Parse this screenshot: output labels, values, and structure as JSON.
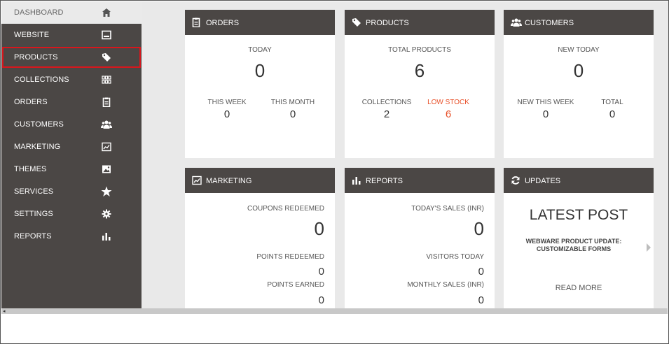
{
  "sidebar": {
    "items": [
      {
        "label": "DASHBOARD",
        "icon": "home-icon"
      },
      {
        "label": "WEBSITE",
        "icon": "window-icon"
      },
      {
        "label": "PRODUCTS",
        "icon": "tag-icon"
      },
      {
        "label": "COLLECTIONS",
        "icon": "grid-icon"
      },
      {
        "label": "ORDERS",
        "icon": "clipboard-icon"
      },
      {
        "label": "CUSTOMERS",
        "icon": "users-icon"
      },
      {
        "label": "MARKETING",
        "icon": "chart-icon"
      },
      {
        "label": "THEMES",
        "icon": "image-icon"
      },
      {
        "label": "SERVICES",
        "icon": "star-icon"
      },
      {
        "label": "SETTINGS",
        "icon": "gear-icon"
      },
      {
        "label": "REPORTS",
        "icon": "bar-chart-icon"
      }
    ]
  },
  "orders": {
    "title": "ORDERS",
    "today_label": "TODAY",
    "today_value": "0",
    "week_label": "THIS WEEK",
    "week_value": "0",
    "month_label": "THIS MONTH",
    "month_value": "0"
  },
  "products": {
    "title": "PRODUCTS",
    "total_label": "TOTAL PRODUCTS",
    "total_value": "6",
    "collections_label": "COLLECTIONS",
    "collections_value": "2",
    "lowstock_label": "LOW STOCK",
    "lowstock_value": "6"
  },
  "customers": {
    "title": "CUSTOMERS",
    "new_today_label": "NEW TODAY",
    "new_today_value": "0",
    "new_week_label": "NEW THIS WEEK",
    "new_week_value": "0",
    "total_label": "TOTAL",
    "total_value": "0"
  },
  "marketing": {
    "title": "MARKETING",
    "coupons_label": "COUPONS REDEEMED",
    "coupons_value": "0",
    "points_redeemed_label": "POINTS REDEEMED",
    "points_redeemed_value": "0",
    "points_earned_label": "POINTS EARNED",
    "points_earned_value": "0"
  },
  "reports": {
    "title": "REPORTS",
    "today_sales_label": "TODAY'S SALES (INR)",
    "today_sales_value": "0",
    "visitors_label": "VISITORS TODAY",
    "visitors_value": "0",
    "monthly_label": "MONTHLY SALES (INR)",
    "monthly_value": "0"
  },
  "updates": {
    "title": "UPDATES",
    "heading": "LATEST POST",
    "post_line1": "WEBWARE PRODUCT UPDATE:",
    "post_line2": "CUSTOMIZABLE FORMS",
    "read_more": "READ MORE"
  },
  "colors": {
    "dark": "#4b4745",
    "panel": "#e9e9e9",
    "low_stock": "#e8512a",
    "highlight": "#d9161c"
  }
}
